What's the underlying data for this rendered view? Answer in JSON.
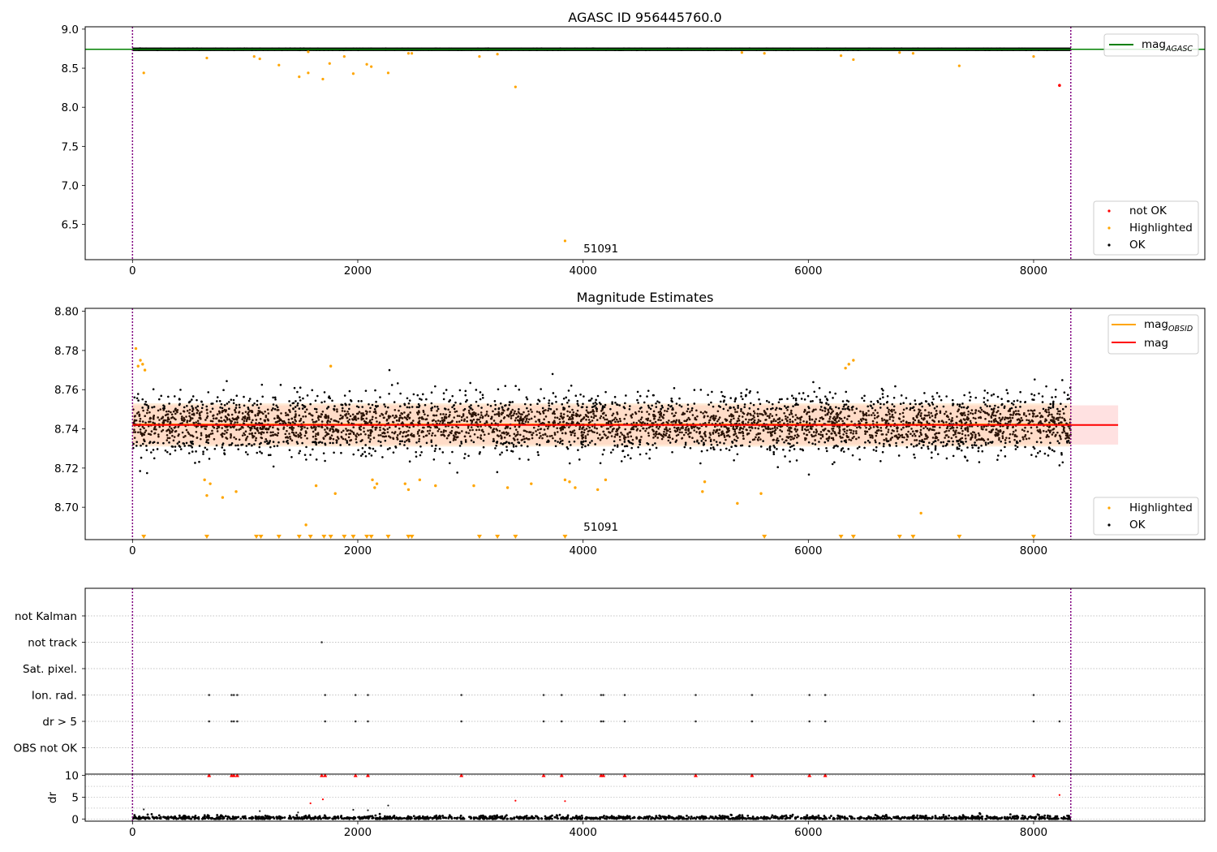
{
  "colors": {
    "ok": "#000000",
    "not_ok": "#ff0000",
    "highlighted": "#ffa500",
    "agasc_line": "#008000",
    "obsid_line": "#ffa500",
    "mag_line": "#ff0000",
    "band": "#ffc8c8",
    "bound": "#800080",
    "grid": "#b0b0b0"
  },
  "chart_data": [
    {
      "type": "scatter",
      "title": "AGASC ID 956445760.0",
      "xlim": [
        -420,
        9520
      ],
      "ylim": [
        6.05,
        9.03
      ],
      "xticks": [
        0,
        2000,
        4000,
        6000,
        8000
      ],
      "yticks": [
        6.5,
        7.0,
        7.5,
        8.0,
        8.5,
        9.0
      ],
      "ytick_labels": [
        "6.5",
        "7.0",
        "7.5",
        "8.0",
        "8.5",
        "9.0"
      ],
      "obsid_annotation": {
        "text": "51091",
        "x": 4000,
        "y": 6.08
      },
      "time_bounds": [
        0,
        8330
      ],
      "mag_agasc": 8.742,
      "ok_band": {
        "x": [
          0,
          8330
        ],
        "y_center": 8.742,
        "y_spread": 0.024
      },
      "highlighted_points": [
        [
          100,
          8.44
        ],
        [
          660,
          8.63
        ],
        [
          1080,
          8.65
        ],
        [
          1130,
          8.62
        ],
        [
          1300,
          8.54
        ],
        [
          1480,
          8.39
        ],
        [
          1560,
          8.44
        ],
        [
          1560,
          8.71
        ],
        [
          1690,
          8.36
        ],
        [
          1750,
          8.56
        ],
        [
          1880,
          8.65
        ],
        [
          1960,
          8.43
        ],
        [
          2080,
          8.55
        ],
        [
          2120,
          8.52
        ],
        [
          2270,
          8.44
        ],
        [
          2450,
          8.69
        ],
        [
          2480,
          8.69
        ],
        [
          3080,
          8.65
        ],
        [
          3240,
          8.68
        ],
        [
          3400,
          8.26
        ],
        [
          3840,
          6.29
        ],
        [
          5410,
          8.7
        ],
        [
          5610,
          8.69
        ],
        [
          6290,
          8.66
        ],
        [
          6400,
          8.61
        ],
        [
          6810,
          8.7
        ],
        [
          6930,
          8.69
        ],
        [
          7340,
          8.53
        ],
        [
          8000,
          8.65
        ]
      ],
      "not_ok_points": [
        [
          8230,
          8.28
        ]
      ],
      "legend_lines": [
        {
          "label": "mag",
          "sub": "AGASC"
        }
      ],
      "legend_points": [
        {
          "label": "not OK",
          "color": "not_ok"
        },
        {
          "label": "Highlighted",
          "color": "highlighted"
        },
        {
          "label": "OK",
          "color": "ok"
        }
      ]
    },
    {
      "type": "scatter",
      "title": "Magnitude Estimates",
      "xlim": [
        -420,
        9520
      ],
      "ylim": [
        8.6835,
        8.8015
      ],
      "xticks": [
        0,
        2000,
        4000,
        6000,
        8000
      ],
      "yticks": [
        8.7,
        8.72,
        8.74,
        8.76,
        8.78,
        8.8
      ],
      "ytick_labels": [
        "8.70",
        "8.72",
        "8.74",
        "8.76",
        "8.78",
        "8.80"
      ],
      "obsid_annotation": {
        "text": "51091",
        "x": 4000,
        "y": 8.6855
      },
      "time_bounds": [
        0,
        8330
      ],
      "mag": 8.742,
      "mag_band": {
        "x": [
          0,
          8750
        ],
        "y": [
          8.732,
          8.752
        ]
      },
      "mag_obsid_band": {
        "x": [
          0,
          8330
        ],
        "y": [
          8.731,
          8.753
        ]
      },
      "ok_cloud": {
        "x": [
          0,
          8330
        ],
        "center": 8.742,
        "spread": 0.0075
      },
      "highlighted_points": [
        [
          30,
          8.781
        ],
        [
          50,
          8.772
        ],
        [
          70,
          8.775
        ],
        [
          90,
          8.773
        ],
        [
          110,
          8.77
        ],
        [
          640,
          8.714
        ],
        [
          660,
          8.706
        ],
        [
          690,
          8.712
        ],
        [
          800,
          8.705
        ],
        [
          920,
          8.708
        ],
        [
          1540,
          8.691
        ],
        [
          1630,
          8.711
        ],
        [
          1760,
          8.772
        ],
        [
          1800,
          8.707
        ],
        [
          2130,
          8.714
        ],
        [
          2150,
          8.71
        ],
        [
          2170,
          8.712
        ],
        [
          2420,
          8.712
        ],
        [
          2450,
          8.709
        ],
        [
          2550,
          8.714
        ],
        [
          2690,
          8.711
        ],
        [
          3030,
          8.711
        ],
        [
          3330,
          8.71
        ],
        [
          3540,
          8.712
        ],
        [
          3840,
          8.714
        ],
        [
          3880,
          8.713
        ],
        [
          3930,
          8.71
        ],
        [
          4130,
          8.709
        ],
        [
          4200,
          8.714
        ],
        [
          5060,
          8.708
        ],
        [
          5080,
          8.713
        ],
        [
          5370,
          8.702
        ],
        [
          5580,
          8.707
        ],
        [
          6330,
          8.771
        ],
        [
          6360,
          8.773
        ],
        [
          6400,
          8.775
        ],
        [
          7000,
          8.697
        ]
      ],
      "clipped_markers_x": [
        100,
        660,
        1100,
        1140,
        1300,
        1480,
        1580,
        1700,
        1760,
        1880,
        1960,
        2080,
        2120,
        2270,
        2450,
        2480,
        3080,
        3240,
        3400,
        3840,
        5610,
        6290,
        6400,
        6810,
        6930,
        7340,
        8000
      ],
      "legend_lines": [
        {
          "label": "mag",
          "sub": "OBSID",
          "color": "obsid_line"
        },
        {
          "label": "mag",
          "sub": "",
          "color": "mag_line"
        }
      ],
      "legend_points": [
        {
          "label": "Highlighted",
          "color": "highlighted"
        },
        {
          "label": "OK",
          "color": "ok"
        }
      ]
    },
    {
      "type": "scatter",
      "title": "",
      "xlim": [
        -420,
        9520
      ],
      "xticks": [
        0,
        2000,
        4000,
        6000,
        8000
      ],
      "time_bounds": [
        0,
        8330
      ],
      "flag_rows": [
        "not Kalman",
        "not track",
        "Sat. pixel.",
        "Ion. rad.",
        "dr > 5",
        "OBS not OK"
      ],
      "flag_points": {
        "not track": [
          1680
        ],
        "Ion. rad.": [
          680,
          880,
          900,
          930,
          1710,
          1980,
          2090,
          2920,
          3650,
          3810,
          4160,
          4180,
          4370,
          5000,
          5500,
          6010,
          6150,
          8000
        ],
        "dr > 5": [
          680,
          880,
          900,
          930,
          1710,
          1980,
          2090,
          2920,
          3650,
          3810,
          4160,
          4180,
          4370,
          5000,
          5500,
          6010,
          6150,
          8000,
          8230
        ]
      },
      "dr_ylabel": "dr",
      "dr_ylim": [
        -0.5,
        10.3
      ],
      "dr_yticks": [
        0,
        5,
        10
      ],
      "dr_capped_x": [
        680,
        880,
        900,
        930,
        1680,
        1710,
        1980,
        2090,
        2920,
        3650,
        3810,
        4160,
        4180,
        4370,
        5000,
        5500,
        6010,
        6150,
        8000
      ],
      "dr_outliers": [
        [
          100,
          2.2
        ],
        [
          1130,
          1.8
        ],
        [
          1470,
          1.5
        ],
        [
          1580,
          3.6
        ],
        [
          1690,
          4.5
        ],
        [
          1960,
          2.1
        ],
        [
          2090,
          2.0
        ],
        [
          2270,
          3.1
        ],
        [
          3400,
          4.2
        ],
        [
          3840,
          4.1
        ],
        [
          8230,
          5.5
        ]
      ]
    }
  ]
}
